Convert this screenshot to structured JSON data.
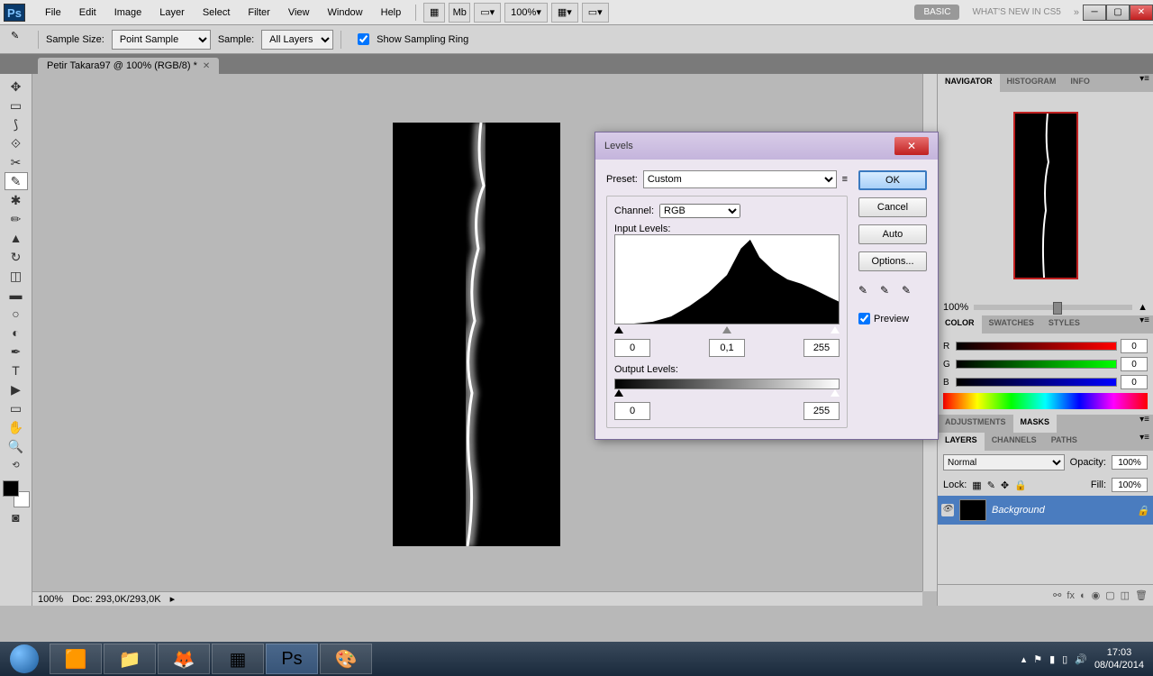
{
  "menubar": {
    "items": [
      "File",
      "Edit",
      "Image",
      "Layer",
      "Select",
      "Filter",
      "View",
      "Window",
      "Help"
    ],
    "zoom": "100%",
    "workspace": "BASIC",
    "whats_new": "WHAT'S NEW IN CS5"
  },
  "optbar": {
    "sample_size_label": "Sample Size:",
    "sample_size": "Point Sample",
    "sample_label": "Sample:",
    "sample": "All Layers",
    "show_ring": "Show Sampling Ring"
  },
  "tab": {
    "title": "Petir Takara97 @ 100% (RGB/8) *"
  },
  "status": {
    "zoom": "100%",
    "doc": "Doc: 293,0K/293,0K"
  },
  "panels": {
    "nav_tabs": [
      "NAVIGATOR",
      "HISTOGRAM",
      "INFO"
    ],
    "nav_zoom": "100%",
    "color_tabs": [
      "COLOR",
      "SWATCHES",
      "STYLES"
    ],
    "color": {
      "r": "0",
      "g": "0",
      "b": "0",
      "labels": [
        "R",
        "G",
        "B"
      ]
    },
    "adj_tabs": [
      "ADJUSTMENTS",
      "MASKS"
    ],
    "layer_tabs": [
      "LAYERS",
      "CHANNELS",
      "PATHS"
    ],
    "blend": "Normal",
    "opacity_label": "Opacity:",
    "opacity": "100%",
    "lock_label": "Lock:",
    "fill_label": "Fill:",
    "fill": "100%",
    "layer_name": "Background"
  },
  "dialog": {
    "title": "Levels",
    "preset_label": "Preset:",
    "preset": "Custom",
    "channel_label": "Channel:",
    "channel": "RGB",
    "input_label": "Input Levels:",
    "in_black": "0",
    "in_gamma": "0,1",
    "in_white": "255",
    "output_label": "Output Levels:",
    "out_black": "0",
    "out_white": "255",
    "ok": "OK",
    "cancel": "Cancel",
    "auto": "Auto",
    "options": "Options...",
    "preview": "Preview"
  },
  "taskbar": {
    "time": "17:03",
    "date": "08/04/2014"
  }
}
